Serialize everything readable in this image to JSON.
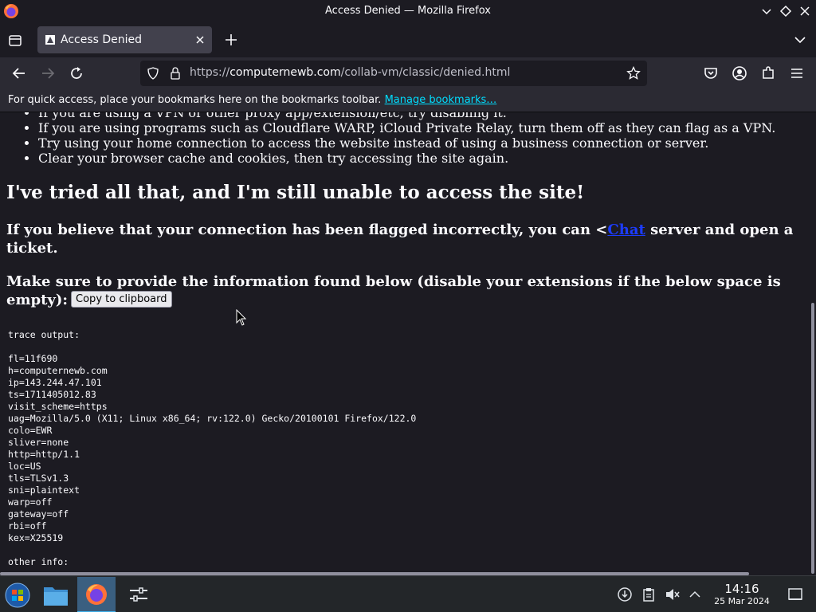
{
  "window": {
    "title": "Access Denied — Mozilla Firefox"
  },
  "tab": {
    "label": "Access Denied"
  },
  "urlbar": {
    "scheme": "https://",
    "host": "computernewb.com",
    "path": "/collab-vm/classic/denied.html"
  },
  "bookmarks_bar": {
    "text": "For quick access, place your bookmarks here on the bookmarks toolbar.",
    "link": "Manage bookmarks…"
  },
  "page": {
    "bullets": [
      "If you are using a VPN or other proxy app/extension/etc, try disabling it.",
      "If you are using programs such as Cloudflare WARP, iCloud Private Relay, turn them off as they can flag as a VPN.",
      "Try using your home connection to access the website instead of using a business connection or server.",
      "Clear your browser cache and cookies, then try accessing the site again."
    ],
    "heading": "I've tried all that, and I'm still unable to access the site!",
    "para1_before": "If you believe that your connection has been flagged incorrectly, you can <",
    "para1_link": "Chat",
    "para1_after": " server and open a ticket.",
    "para2": "Make sure to provide the information found below (disable your extensions if the below space is empty):",
    "copy_button": "Copy to clipboard",
    "trace_text": "trace output:\n\nfl=11f690\nh=computernewb.com\nip=143.244.47.101\nts=1711405012.83\nvisit_scheme=https\nuag=Mozilla/5.0 (X11; Linux x86_64; rv:122.0) Gecko/20100101 Firefox/122.0\ncolo=EWR\nsliver=none\nhttp=http/1.1\nloc=US\ntls=TLSv1.3\nsni=plaintext\nwarp=off\ngateway=off\nrbi=off\nkex=X25519\n\nother info:"
  },
  "taskbar": {
    "time": "14:16",
    "date": "25 Mar 2024"
  },
  "colors": {
    "chrome_bg": "#1c1b22",
    "toolbar_bg": "#2b2a33",
    "link": "#00ddff",
    "page_link": "#1c3cff",
    "taskbar_bg": "#232629"
  }
}
